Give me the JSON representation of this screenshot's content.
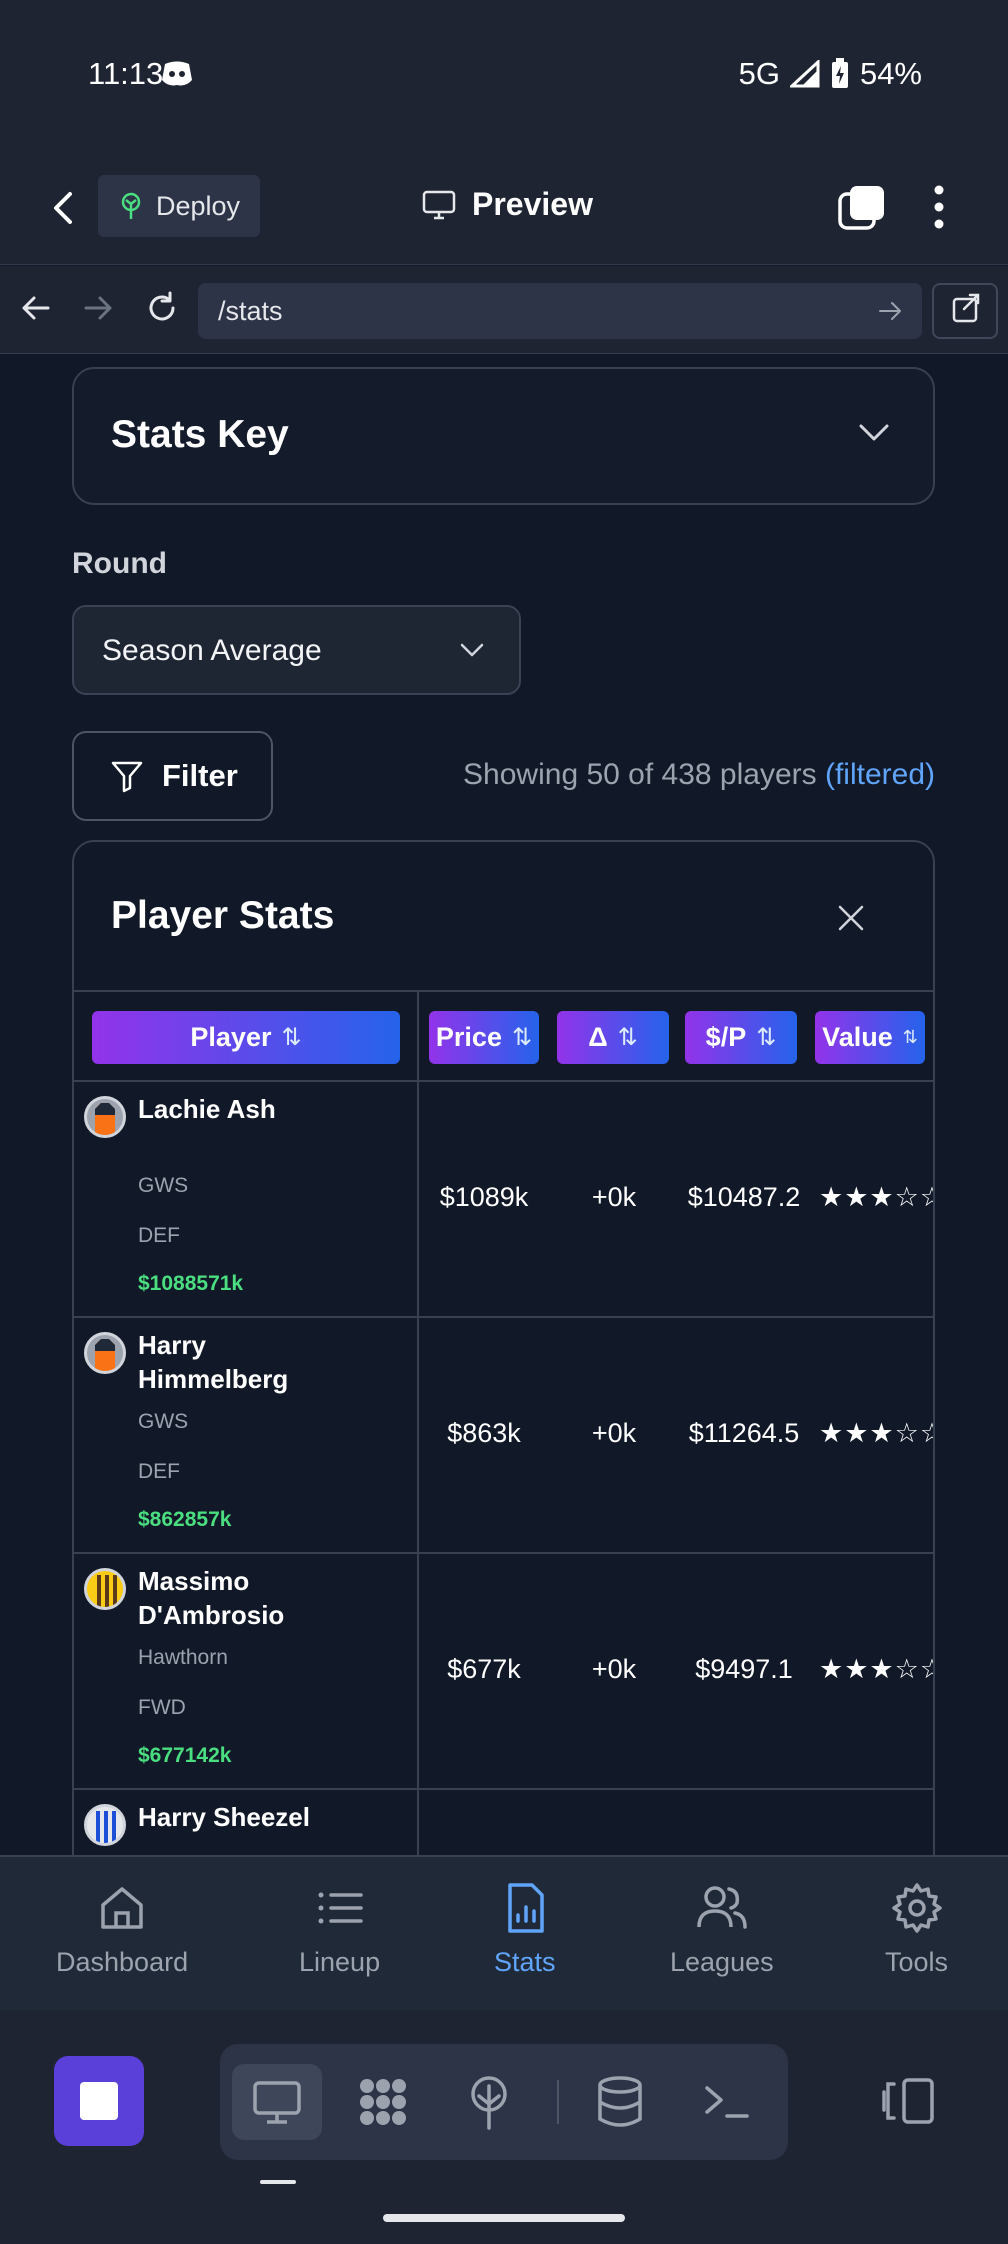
{
  "status_bar": {
    "time": "11:13",
    "network": "5G",
    "battery": "54%"
  },
  "header": {
    "deploy_label": "Deploy",
    "preview_label": "Preview"
  },
  "browser": {
    "url": "/stats"
  },
  "stats_key": {
    "title": "Stats Key"
  },
  "round": {
    "label": "Round",
    "selected": "Season Average"
  },
  "filter": {
    "button_label": "Filter",
    "showing_text": "Showing 50 of 438 players",
    "filtered_label": "(filtered)"
  },
  "player_stats": {
    "title": "Player Stats",
    "columns": {
      "player": "Player",
      "price": "Price",
      "delta": "Δ",
      "sp": "$/P",
      "value": "Value"
    },
    "sort_glyph": "⇅",
    "rows": [
      {
        "name": "Lachie Ash",
        "team": "GWS",
        "position": "DEF",
        "exact_price": "$1088571k",
        "price": "$1089k",
        "delta": "+0k",
        "sp": "$10487.2",
        "value": "★★★☆☆"
      },
      {
        "name": "Harry Himmelberg",
        "team": "GWS",
        "position": "DEF",
        "exact_price": "$862857k",
        "price": "$863k",
        "delta": "+0k",
        "sp": "$11264.5",
        "value": "★★★☆☆"
      },
      {
        "name": "Massimo D'Ambrosio",
        "team": "Hawthorn",
        "position": "FWD",
        "exact_price": "$677142k",
        "price": "$677k",
        "delta": "+0k",
        "sp": "$9497.1",
        "value": "★★★☆☆"
      },
      {
        "name": "Harry Sheezel",
        "team": "",
        "position": "",
        "exact_price": "",
        "price": "",
        "delta": "",
        "sp": "",
        "value": ""
      }
    ]
  },
  "bottom_nav": {
    "items": [
      {
        "label": "Dashboard"
      },
      {
        "label": "Lineup"
      },
      {
        "label": "Stats"
      },
      {
        "label": "Leagues"
      },
      {
        "label": "Tools"
      }
    ],
    "active": "Stats"
  },
  "colors": {
    "accent_blue": "#60a5fa",
    "price_green": "#4ade80",
    "gradient_start": "#9333ea",
    "gradient_end": "#2563eb",
    "stop_button": "#5b3fd9"
  }
}
